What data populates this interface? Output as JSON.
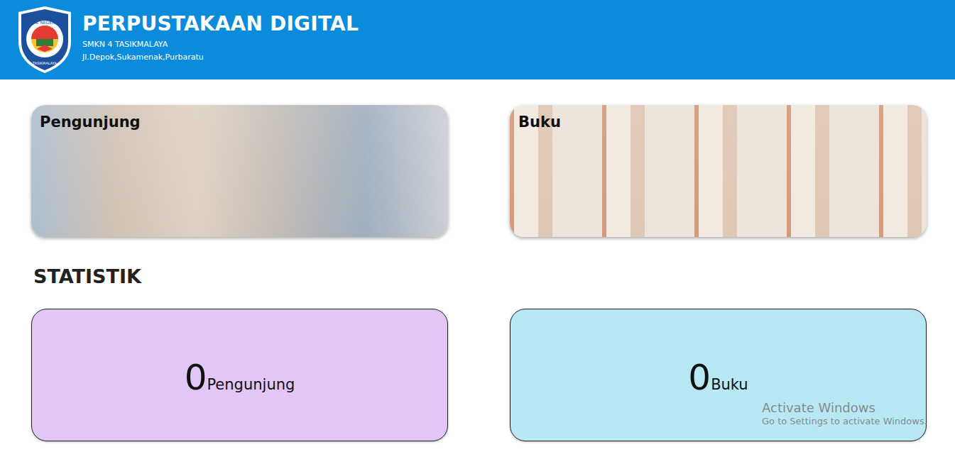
{
  "header": {
    "logo": {
      "top_text": "SMK NEGERI 4",
      "bottom_text": "TASIKMALAYA"
    },
    "title": "PERPUSTAKAAN DIGITAL",
    "school": "SMKN 4 TASIKMALAYA",
    "address": "Jl.Depok,Sukamenak,Purbaratu"
  },
  "menu_cards": [
    {
      "label": "Pengunjung",
      "kind": "visitors"
    },
    {
      "label": "Buku",
      "kind": "books"
    }
  ],
  "statistics": {
    "heading": "STATISTIK",
    "cards": [
      {
        "value": "0",
        "label": "Pengunjung",
        "color": "#e2c6f5"
      },
      {
        "value": "0",
        "label": "Buku",
        "color": "#b8e8f3"
      }
    ]
  },
  "watermark": {
    "title": "Activate Windows",
    "subtitle": "Go to Settings to activate Windows."
  }
}
